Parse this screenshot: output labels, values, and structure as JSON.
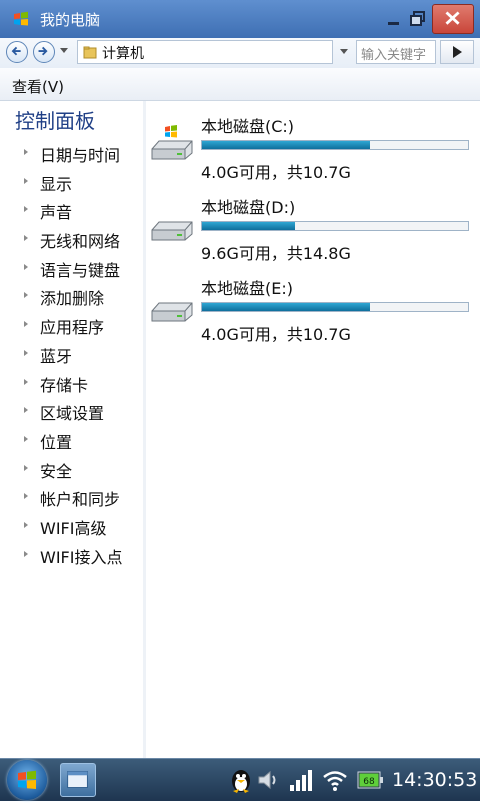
{
  "window": {
    "title": "我的电脑"
  },
  "address": {
    "path": "计算机",
    "search_placeholder": "输入关键字"
  },
  "menu": {
    "view_label": "查看(V)"
  },
  "sidebar": {
    "title": "控制面板",
    "items": [
      {
        "label": "日期与时间"
      },
      {
        "label": "显示"
      },
      {
        "label": "声音"
      },
      {
        "label": "无线和网络"
      },
      {
        "label": "语言与键盘"
      },
      {
        "label": "添加删除"
      },
      {
        "label": "应用程序"
      },
      {
        "label": "蓝牙"
      },
      {
        "label": "存储卡"
      },
      {
        "label": "区域设置"
      },
      {
        "label": "位置"
      },
      {
        "label": "安全"
      },
      {
        "label": "帐户和同步"
      },
      {
        "label": "WIFI高级"
      },
      {
        "label": "WIFI接入点"
      }
    ]
  },
  "drives": [
    {
      "name": "本地磁盘(C:)",
      "free_text": "4.0G可用，共10.7G",
      "used_fraction": 0.63,
      "icon": "windows-drive-icon"
    },
    {
      "name": "本地磁盘(D:)",
      "free_text": "9.6G可用，共14.8G",
      "used_fraction": 0.35,
      "icon": "drive-icon"
    },
    {
      "name": "本地磁盘(E:)",
      "free_text": "4.0G可用，共10.7G",
      "used_fraction": 0.63,
      "icon": "drive-icon"
    }
  ],
  "taskbar": {
    "clock": "14:30:53",
    "battery_level": "68"
  },
  "colors": {
    "titlebar": "#4a7bbf",
    "progress_fill": "#1a86b8",
    "sidebar_title": "#1f3f86",
    "taskbar": "#2a4663",
    "battery_green": "#5fcf3a"
  }
}
